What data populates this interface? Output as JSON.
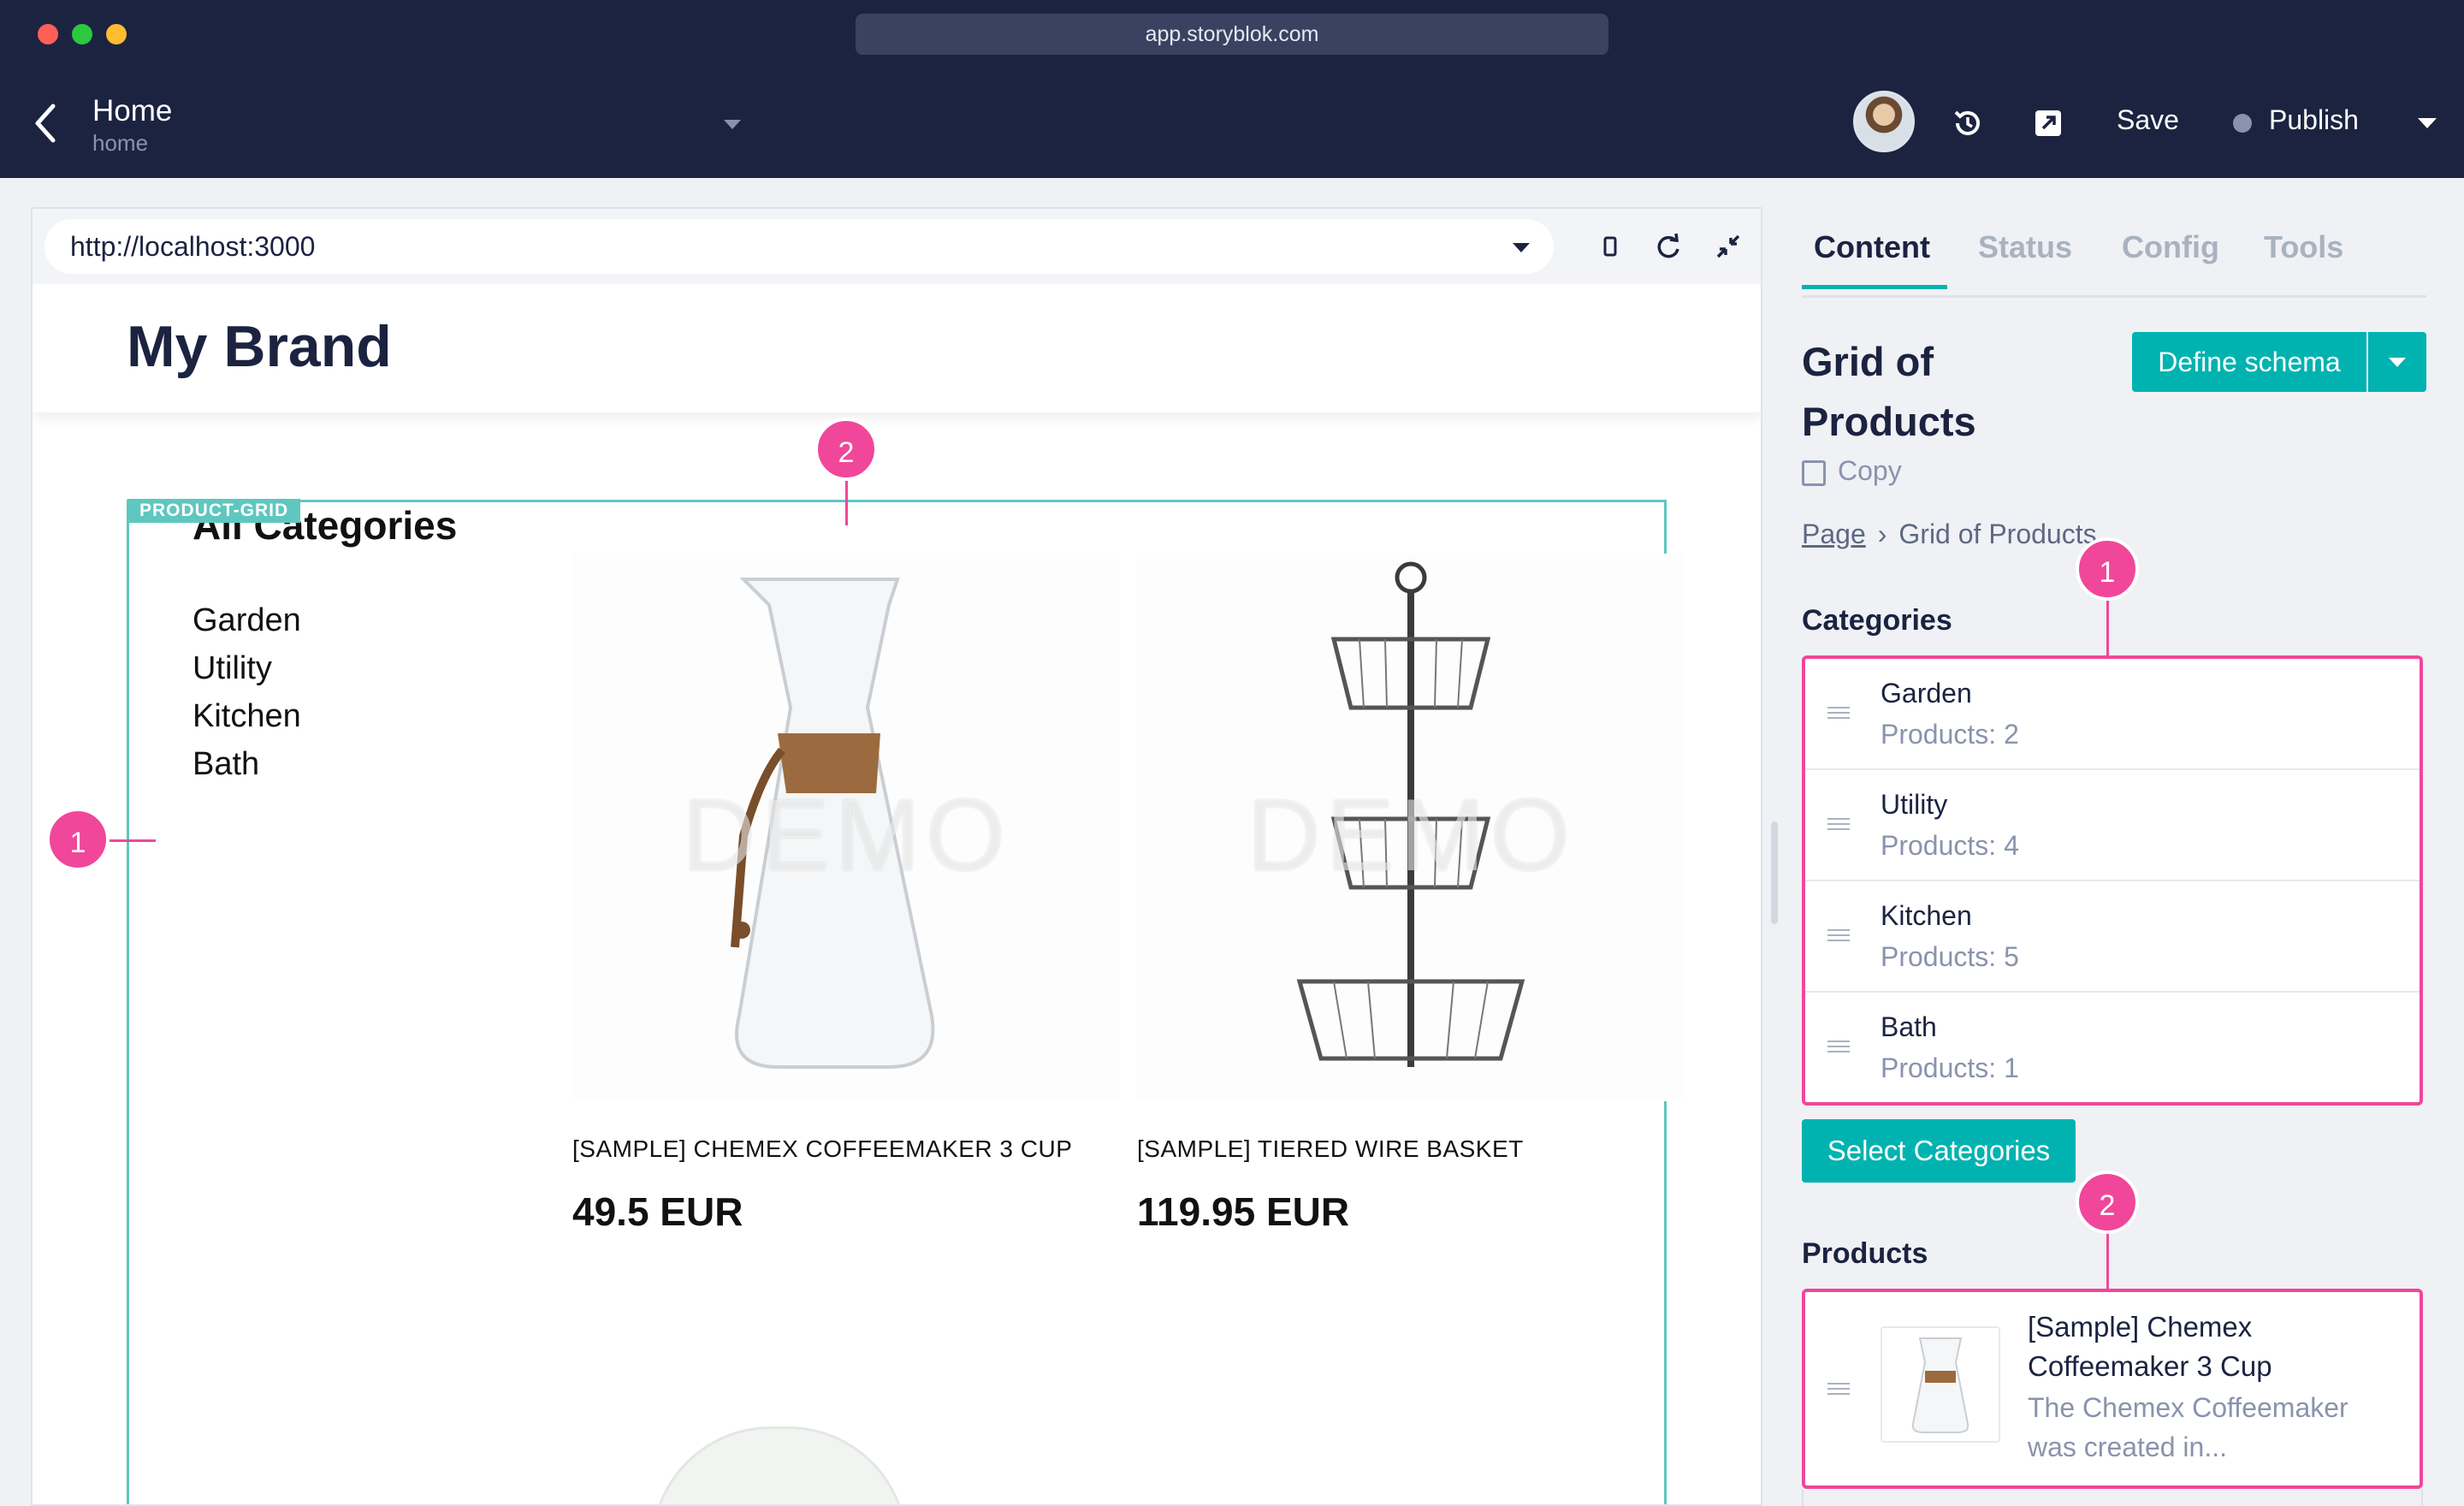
{
  "browser": {
    "url": "app.storyblok.com"
  },
  "header": {
    "story_title": "Home",
    "story_slug": "home",
    "save_label": "Save",
    "publish_label": "Publish"
  },
  "preview": {
    "url": "http://localhost:3000",
    "brand": "My Brand",
    "component_tag": "PRODUCT-GRID",
    "categories_heading": "All Categories",
    "categories": [
      "Garden",
      "Utility",
      "Kitchen",
      "Bath"
    ],
    "watermark": "DEMO",
    "products": [
      {
        "name": "[SAMPLE] CHEMEX COFFEEMAKER 3 CUP",
        "price": "49.5 EUR"
      },
      {
        "name": "[SAMPLE] TIERED WIRE BASKET",
        "price": "119.95 EUR"
      }
    ],
    "markers": [
      "1",
      "2"
    ]
  },
  "sidebar": {
    "tabs": [
      "Content",
      "Status",
      "Config",
      "Tools"
    ],
    "active_tab": "Content",
    "block_title": "Grid of Products",
    "define_schema_label": "Define schema",
    "copy_label": "Copy",
    "breadcrumb": [
      "Page",
      "Grid of Products"
    ],
    "categories_label": "Categories",
    "category_items": [
      {
        "name": "Garden",
        "count": "Products: 2"
      },
      {
        "name": "Utility",
        "count": "Products: 4"
      },
      {
        "name": "Kitchen",
        "count": "Products: 5"
      },
      {
        "name": "Bath",
        "count": "Products: 1"
      }
    ],
    "select_categories_label": "Select Categories",
    "products_label": "Products",
    "product_items": [
      {
        "title": "[Sample] Chemex Coffeemaker 3 Cup",
        "description": "The Chemex Coffeemaker was created in..."
      }
    ]
  },
  "colors": {
    "navy": "#1b2340",
    "teal": "#00b3b0",
    "highlight_pink": "#f0479a",
    "grid_outline": "#5ec7bf"
  }
}
